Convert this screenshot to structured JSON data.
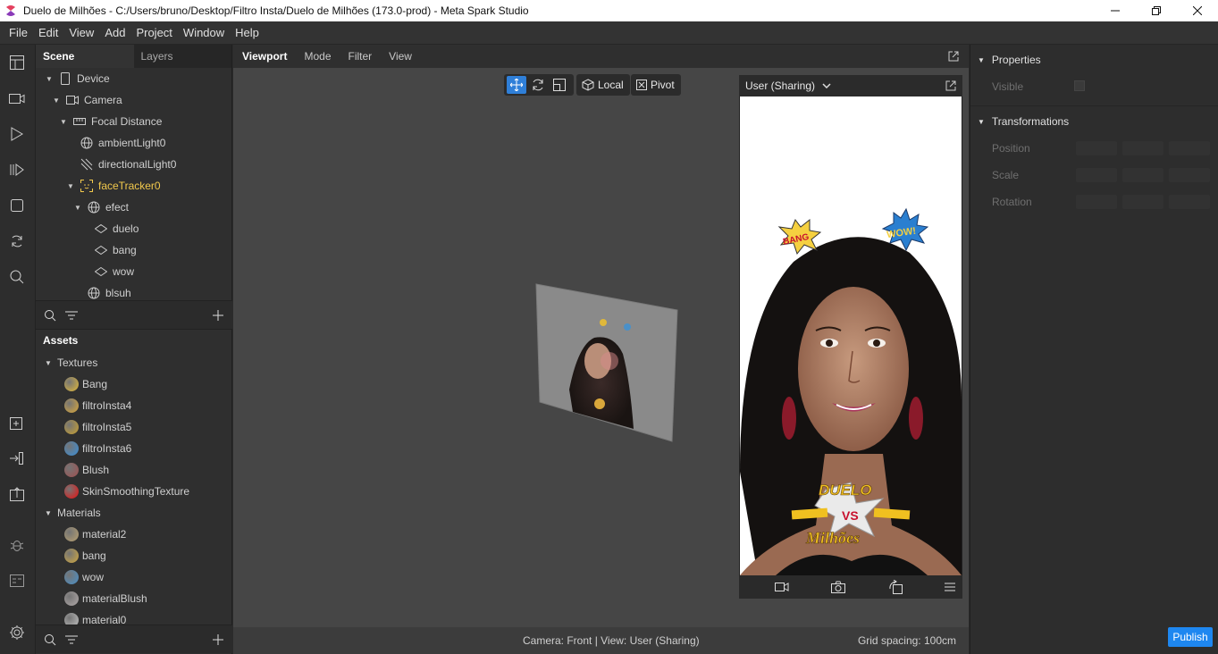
{
  "window": {
    "title": "Duelo de Milhões - C:/Users/bruno/Desktop/Filtro Insta/Duelo de Milhões (173.0-prod) - Meta Spark Studio"
  },
  "menu": [
    "File",
    "Edit",
    "View",
    "Add",
    "Project",
    "Window",
    "Help"
  ],
  "scene": {
    "tabs": {
      "scene": "Scene",
      "layers": "Layers"
    },
    "tree": [
      {
        "label": "Device",
        "icon": "phone-icon"
      },
      {
        "label": "Camera",
        "icon": "camera-icon"
      },
      {
        "label": "Focal Distance",
        "icon": "ruler-icon"
      },
      {
        "label": "ambientLight0",
        "icon": "globe-icon"
      },
      {
        "label": "directionalLight0",
        "icon": "directional-light-icon"
      },
      {
        "label": "faceTracker0",
        "icon": "face-tracker-icon"
      },
      {
        "label": "efect",
        "icon": "globe-icon"
      },
      {
        "label": "duelo",
        "icon": "plane-icon"
      },
      {
        "label": "bang",
        "icon": "plane-icon"
      },
      {
        "label": "wow",
        "icon": "plane-icon"
      },
      {
        "label": "blsuh",
        "icon": "globe-icon"
      }
    ]
  },
  "assets": {
    "title": "Assets",
    "textures_label": "Textures",
    "materials_label": "Materials",
    "textures": [
      {
        "label": "Bang",
        "color": "#e0b83a"
      },
      {
        "label": "filtroInsta4",
        "color": "#d9a73b"
      },
      {
        "label": "filtroInsta5",
        "color": "#c8a030"
      },
      {
        "label": "filtroInsta6",
        "color": "#3a8fd9"
      },
      {
        "label": "Blush",
        "color": "#a05050"
      },
      {
        "label": "SkinSmoothingTexture",
        "color": "#e81010"
      }
    ],
    "materials": [
      {
        "label": "material2",
        "color": "#b8a070"
      },
      {
        "label": "bang",
        "color": "#d0a840"
      },
      {
        "label": "wow",
        "color": "#4a90c8"
      },
      {
        "label": "materialBlush",
        "color": "#b0a8a8"
      },
      {
        "label": "material0",
        "color": "#c0c0c0"
      }
    ]
  },
  "viewport": {
    "tabs": [
      "Viewport",
      "Mode",
      "Filter",
      "View"
    ],
    "local_label": "Local",
    "pivot_label": "Pivot",
    "status_camera": "Camera: Front | View: User (Sharing)",
    "grid_spacing": "Grid spacing: 100cm"
  },
  "simulator": {
    "device_label": "User (Sharing)",
    "sticker_bang": "BANG",
    "sticker_wow": "WOW!",
    "overlay_title": "DUELO",
    "overlay_subtitle": "Milhões",
    "overlay_vs": "VS"
  },
  "properties": {
    "title": "Properties",
    "visible_label": "Visible",
    "transformations_title": "Transformations",
    "position_label": "Position",
    "scale_label": "Scale",
    "rotation_label": "Rotation"
  },
  "publish_label": "Publish"
}
